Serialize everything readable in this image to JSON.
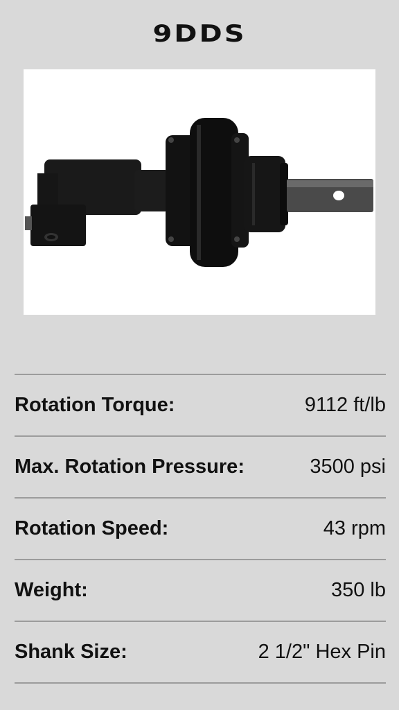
{
  "product": {
    "model": "9DDS"
  },
  "image": {
    "icon": "drive-unit-photo"
  },
  "specs": [
    {
      "label": "Rotation Torque:",
      "value": "9112 ft/lb"
    },
    {
      "label": "Max. Rotation Pressure:",
      "value": "3500 psi"
    },
    {
      "label": "Rotation Speed:",
      "value": "43 rpm"
    },
    {
      "label": "Weight:",
      "value": "350 lb"
    },
    {
      "label": "Shank Size:",
      "value": "2 1/2\" Hex Pin"
    }
  ],
  "colors": {
    "background": "#d9d9d9",
    "divider": "#9c9c9c",
    "text": "#111111"
  }
}
